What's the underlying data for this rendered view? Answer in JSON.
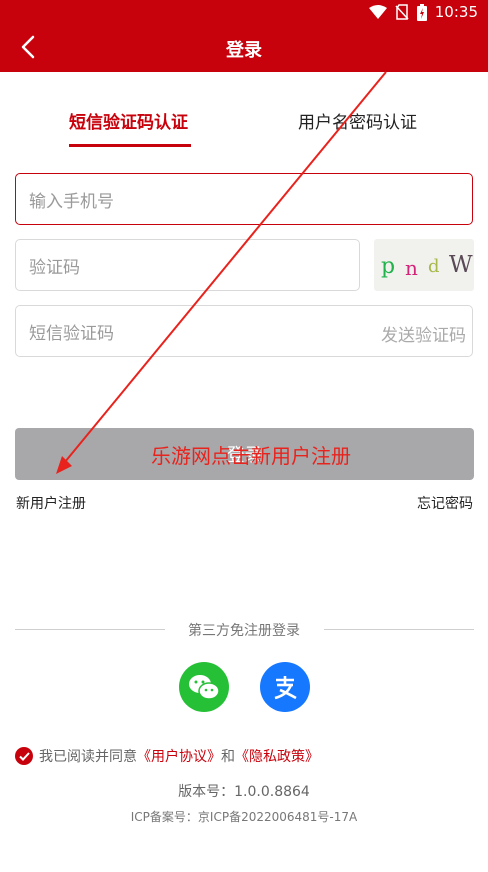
{
  "status_bar": {
    "time": "10:35"
  },
  "header": {
    "title": "登录"
  },
  "tabs": {
    "sms": "短信验证码认证",
    "password": "用户名密码认证"
  },
  "form": {
    "phone_placeholder": "输入手机号",
    "captcha_placeholder": "验证码",
    "sms_placeholder": "短信验证码",
    "send_code": "发送验证码",
    "captcha_chars": [
      "p",
      "n",
      "d",
      "W"
    ]
  },
  "annotation": {
    "text": "乐游网点击新用户注册"
  },
  "login_button": {
    "label": "登录"
  },
  "links": {
    "register": "新用户注册",
    "forgot": "忘记密码"
  },
  "third_party": {
    "label": "第三方免注册登录",
    "providers": [
      "wechat",
      "alipay"
    ]
  },
  "agreement": {
    "prefix": "我已阅读并同意",
    "user_agreement": "《用户协议》",
    "and": "和",
    "privacy_policy": "《隐私政策》"
  },
  "version": "版本号：1.0.0.8864",
  "icp": "ICP备案号：京ICP备2022006481号-17A",
  "colors": {
    "brand": "#c8020c",
    "button_disabled": "#a8a8ab",
    "wechat": "#26c037",
    "alipay": "#1677ff"
  }
}
